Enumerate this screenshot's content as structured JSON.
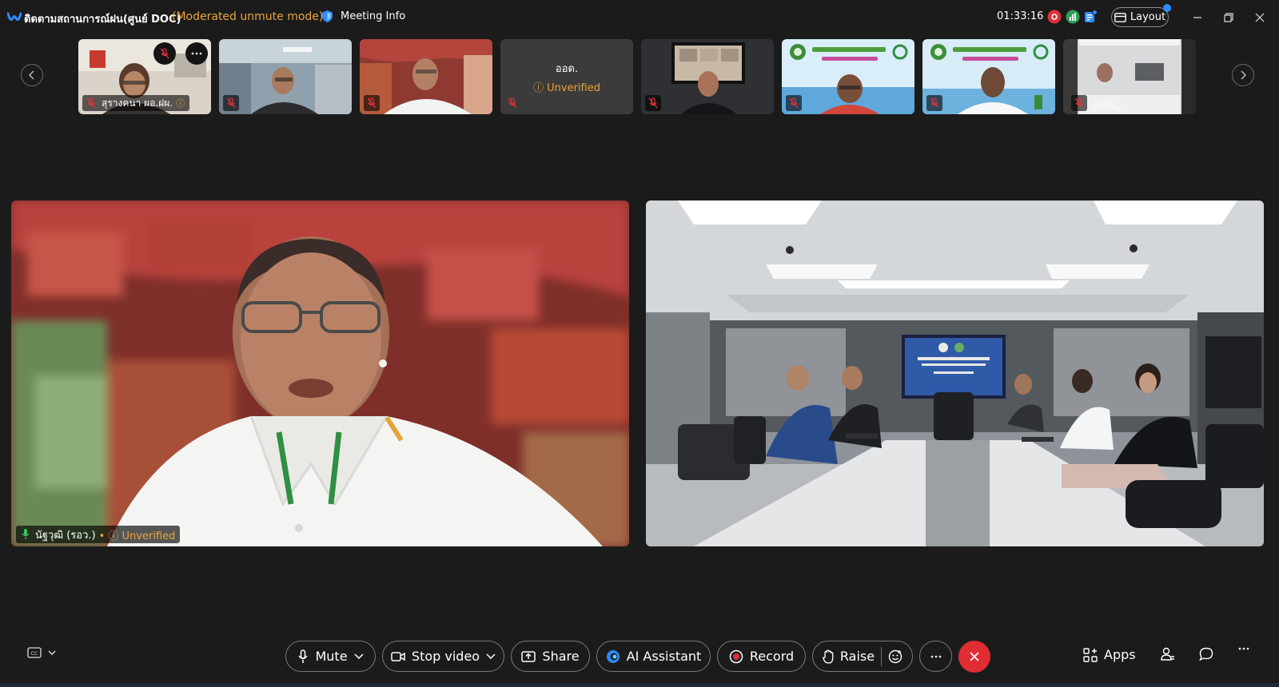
{
  "window": {
    "title": "ติดตามสถานการณ์ฝน(ศูนย์ DOC)",
    "mode": "(Moderated unmute mode)",
    "meeting_info_label": "Meeting Info",
    "timer": "01:33:16",
    "layout_label": "Layout"
  },
  "filmstrip": {
    "thumbnails": [
      {
        "name": "สุรางคนา ผอ.ฝผ.",
        "has_label": true,
        "unverified_icon": "ⓘ"
      },
      {
        "name": "",
        "has_label": false
      },
      {
        "name": "",
        "has_label": false
      },
      {
        "name": "ออด.",
        "status": "Unverified",
        "name_only": true
      },
      {
        "name": "",
        "has_label": false
      },
      {
        "name": "",
        "has_label": false
      },
      {
        "name": "",
        "has_label": false
      },
      {
        "name": "",
        "has_label": false
      }
    ]
  },
  "main": {
    "speaker_name": "นัฐวุฒิ (รอว.)",
    "speaker_status": "Unverified"
  },
  "toolbar": {
    "mute": "Mute",
    "stop_video": "Stop video",
    "share": "Share",
    "ai_assistant": "AI Assistant",
    "record": "Record",
    "raise": "Raise",
    "apps": "Apps"
  },
  "colors": {
    "background": "#1b1b1b",
    "warning": "#e9a53a",
    "end_call": "#e02c33",
    "accent": "#2d8cff"
  }
}
